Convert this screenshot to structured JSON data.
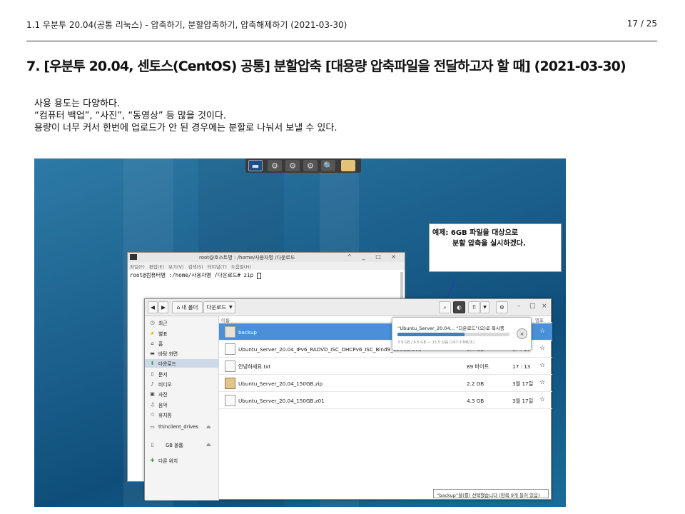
{
  "slide": {
    "doc_title": "1.1 우분투 20.04(공통 리눅스) - 압축하기, 분할압축하기, 압축해제하기 (2021-03-30)",
    "page_num": "17 / 25",
    "heading": "7. [우분투 20.04, 센토스(CentOS) 공통] 분할압축 [대용량 압축파일을 전달하고자 할 때] (2021-03-30)",
    "body_lines": [
      "사용 용도는 다양하다.",
      "“컴퓨터 백업”, “사진”, “동영상” 등 많을 것이다.",
      "용량이 너무 커서 한번에 업로드가 안 된 경우에는 분할로 나눠서 보낼 수 있다."
    ]
  },
  "callout": {
    "line1": "예제: 6GB 파일을 대상으로",
    "line2": "분할 압축을 실시하겠다."
  },
  "terminal": {
    "title": "root@호스트명 : /home/사용자명 /다운로드",
    "window_controls": "^ _ □ ×",
    "menu": "파일(F) 편집(E) 보기(V) 검색(S) 터미널(T) 도움말(H)",
    "prompt": "root@컴퓨터명 :/home/사용자명 /다운로드# zip"
  },
  "file_manager": {
    "back_icon": "arrow-left",
    "forward_icon": "arrow-right",
    "home_label": "내 폴더",
    "path_label": "다운로드",
    "column_name": "이름",
    "column_end": "별표",
    "sidebar": [
      {
        "icon": "clock",
        "label": "최근"
      },
      {
        "icon": "star",
        "label": "별표"
      },
      {
        "icon": "home",
        "label": "홈"
      },
      {
        "icon": "desktop",
        "label": "바탕 화면"
      },
      {
        "icon": "download",
        "label": "다운로드"
      },
      {
        "icon": "document",
        "label": "문서"
      },
      {
        "icon": "music",
        "label": "비디오"
      },
      {
        "icon": "camera",
        "label": "사진"
      },
      {
        "icon": "note",
        "label": "음악"
      },
      {
        "icon": "trash",
        "label": "휴지통"
      },
      {
        "icon": "drive",
        "label": "thinclient_drives"
      },
      {
        "icon": "usb",
        "label": "GB 볼륨"
      },
      {
        "icon": "plus",
        "label": "다른 위치"
      }
    ],
    "files": [
      {
        "name": "backup",
        "size": "",
        "time": "",
        "kind": "folder"
      },
      {
        "name": "Ubuntu_Server_20.04_IPv6_RADVD_ISC_DHCPv6_ISC_Bind9_150GB.ova",
        "size": "6.4 GB",
        "time": "17 : 10",
        "kind": "file"
      },
      {
        "name": "안녕하세요.txt",
        "size": "89 바이트",
        "time": "17 : 13",
        "kind": "text"
      },
      {
        "name": "Ubuntu_Server_20.04_150GB.zip",
        "size": "2.2 GB",
        "time": "3월 17일",
        "kind": "zip"
      },
      {
        "name": "Ubuntu_Server_20.04_150GB.z01",
        "size": "4.3 GB",
        "time": "3월 17일",
        "kind": "file"
      }
    ],
    "status": "“backup”을(를) 선택했습니다 (항목 9개 들어 있음)"
  },
  "copy_popover": {
    "text": "“Ubuntu_Server_20.04… “다운로드”(으)로 복사중",
    "detail": "3.9 GB / 6.5 GB — 15.5 남음 (167.3 MB/초)",
    "progress": 0.6
  },
  "colors": {
    "selection": "#4a90d9",
    "desktop": "#1b5f8c",
    "progress": "#3f7fd0"
  }
}
